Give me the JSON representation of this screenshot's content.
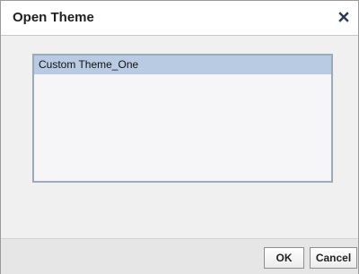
{
  "dialog": {
    "title": "Open Theme",
    "close_icon": "close-icon"
  },
  "theme_list": {
    "items": [
      {
        "label": "Custom Theme_One",
        "selected": true
      }
    ]
  },
  "footer": {
    "ok_label": "OK",
    "cancel_label": "Cancel"
  },
  "colors": {
    "selection": "#b9cbe2",
    "list_border": "#9aaab9",
    "panel_background": "#f0f0f0"
  }
}
